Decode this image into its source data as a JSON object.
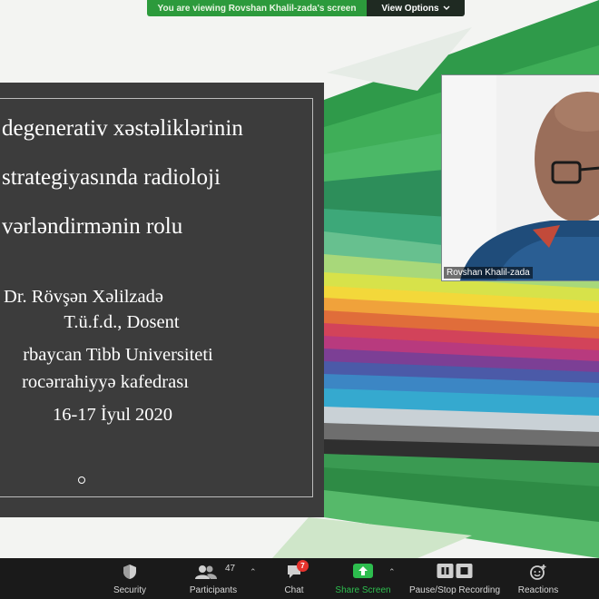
{
  "share_banner": {
    "message": "You are viewing Rovshan Khalil-zada's screen",
    "view_options_label": "View Options",
    "accent_color": "#2c9a3c"
  },
  "slide": {
    "title_lines": [
      "degenerativ xəstəliklərinin",
      "strategiyasında radioloji",
      "vərləndirmənin rolu"
    ],
    "info_lines": [
      "Dr. Rövşən Xəlilzadə",
      "T.ü.f.d., Dosent",
      "rbaycan Tibb Universiteti",
      "rocərrahiyyə kafedrası",
      "16-17 İyul 2020"
    ],
    "background_color": "#3c3c3c"
  },
  "video": {
    "participant_name": "Rovshan Khalil-zada"
  },
  "toolbar": {
    "security_label": "Security",
    "participants_label": "Participants",
    "participants_count": "47",
    "chat_label": "Chat",
    "chat_badge": "7",
    "share_label": "Share Screen",
    "record_label": "Pause/Stop Recording",
    "reactions_label": "Reactions",
    "share_color": "#2dbd4e"
  },
  "icons": [
    "shield-icon",
    "participants-icon",
    "chat-icon",
    "share-screen-icon",
    "pause-icon",
    "stop-icon",
    "reactions-icon",
    "chevron-down-icon",
    "caret-up-icon"
  ]
}
